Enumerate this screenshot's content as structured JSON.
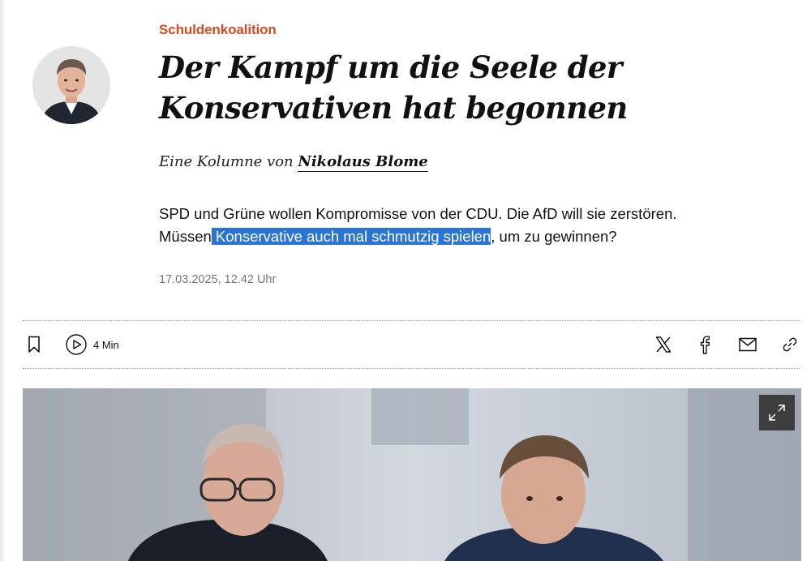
{
  "article": {
    "kicker": "Schuldenkoalition",
    "headline": "Der Kampf um die Seele der Konservativen hat begonnen",
    "byline_prefix": "Eine Kolumne von",
    "author": "Nikolaus Blome",
    "lead_before": "SPD und Grüne wollen Kompromisse von der CDU. Die AfD will sie zerstören. Müssen",
    "lead_selected": " Konservative auch mal schmutzig spielen",
    "lead_after": ", um zu gewinnen?",
    "date": "17.03.2025, 12.42 Uhr"
  },
  "toolbar": {
    "listen_duration": "4 Min",
    "icons": [
      "bookmark-icon",
      "play-icon",
      "x-icon",
      "facebook-icon",
      "mail-icon",
      "link-icon"
    ]
  },
  "colors": {
    "kicker": "#d44a1f",
    "selection": "#2a74d6",
    "date": "#777777",
    "expand_button": "#3e3e3e"
  }
}
